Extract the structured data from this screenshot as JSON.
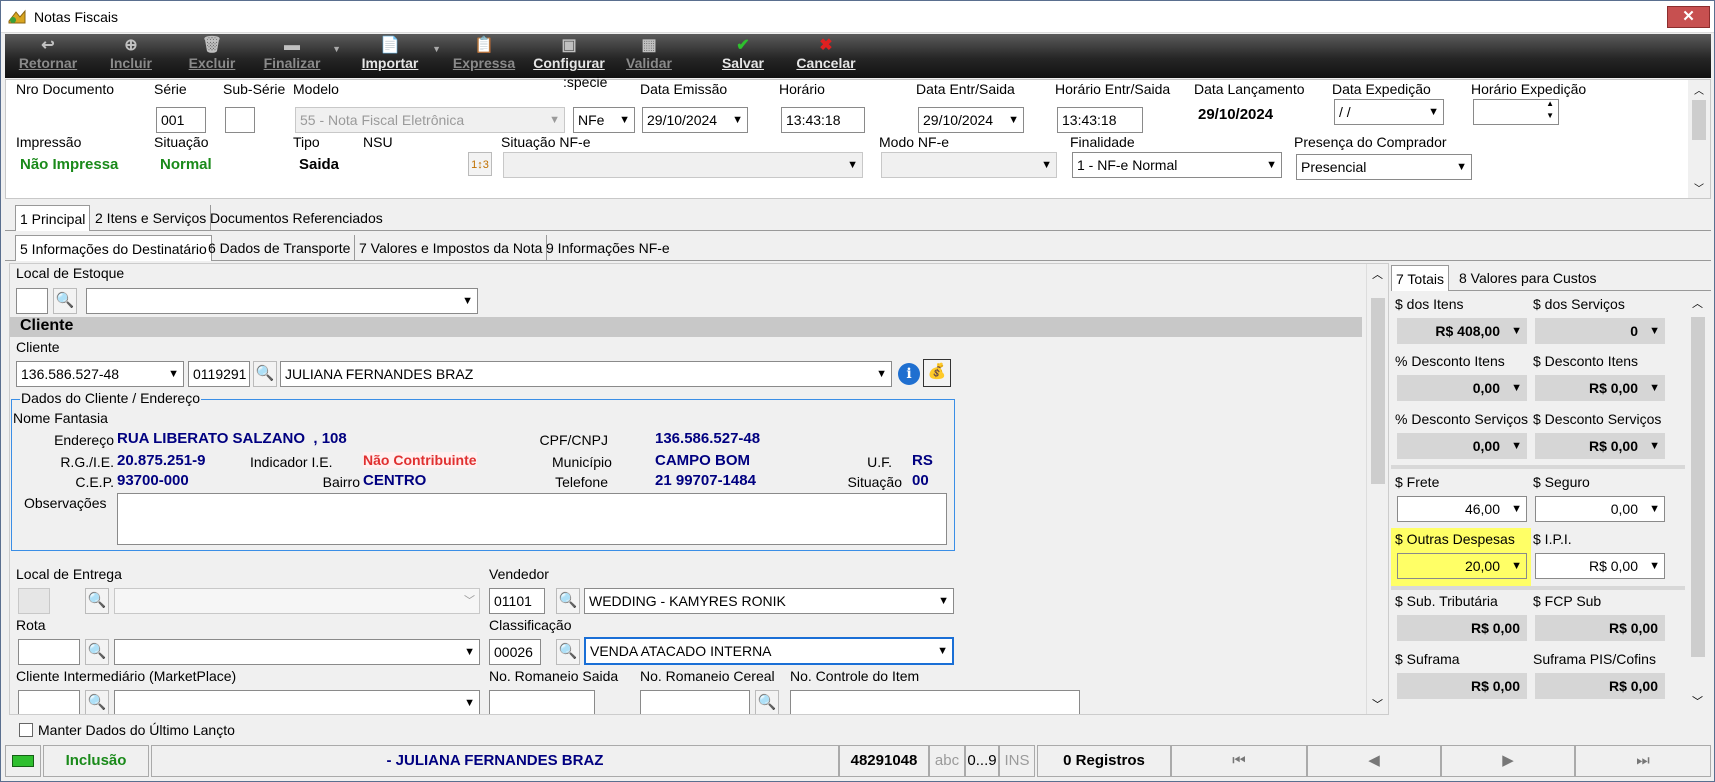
{
  "window": {
    "title": "Notas Fiscais",
    "close": "✕"
  },
  "toolbar": [
    {
      "label": "Retornar",
      "icon": "back-icon",
      "glyph": "↩",
      "enabled": false
    },
    {
      "label": "Incluir",
      "icon": "add-icon",
      "glyph": "⊕",
      "enabled": false
    },
    {
      "label": "Excluir",
      "icon": "trash-icon",
      "glyph": "🗑",
      "enabled": false
    },
    {
      "label": "Finalizar",
      "icon": "finish-icon",
      "glyph": "▬",
      "enabled": false
    },
    {
      "label": "Importar",
      "icon": "import-icon",
      "glyph": "📄",
      "enabled": true
    },
    {
      "label": "Expressa",
      "icon": "express-icon",
      "glyph": "📋",
      "enabled": false
    },
    {
      "label": "Configurar",
      "icon": "config-icon",
      "glyph": "▣",
      "enabled": true
    },
    {
      "label": "Validar",
      "icon": "validate-icon",
      "glyph": "▦",
      "enabled": false
    },
    {
      "label": "Salvar",
      "icon": "check-icon",
      "glyph": "✔",
      "enabled": true
    },
    {
      "label": "Cancelar",
      "icon": "cancel-icon",
      "glyph": "✖",
      "enabled": true
    }
  ],
  "header": {
    "nro_documento": {
      "label": "Nro Documento"
    },
    "serie": {
      "label": "Série",
      "value": "001"
    },
    "sub_serie": {
      "label": "Sub-Série",
      "value": ""
    },
    "modelo": {
      "label": "Modelo",
      "value": "55 - Nota Fiscal Eletrônica"
    },
    "especie": {
      "label": ":specie",
      "value": "NFe"
    },
    "data_emissao": {
      "label": "Data Emissão",
      "value": "29/10/2024"
    },
    "horario": {
      "label": "Horário",
      "value": "13:43:18"
    },
    "data_entr_saida": {
      "label": "Data Entr/Saida",
      "value": "29/10/2024"
    },
    "horario_entr_saida": {
      "label": "Horário Entr/Saida",
      "value": "13:43:18"
    },
    "data_lancamento": {
      "label": "Data Lançamento",
      "value": "29/10/2024"
    },
    "data_expedicao": {
      "label": "Data Expedição",
      "value": " / /"
    },
    "horario_expedicao": {
      "label": "Horário Expedição",
      "value": ""
    },
    "impressao": {
      "label": "Impressão",
      "value": "Não Impressa"
    },
    "situacao": {
      "label": "Situação",
      "value": "Normal"
    },
    "tipo": {
      "label": "Tipo",
      "value": "Saida"
    },
    "nsu": {
      "label": "NSU"
    },
    "situacao_nfe": {
      "label": "Situação NF-e",
      "value": ""
    },
    "modo_nfe": {
      "label": "Modo NF-e",
      "value": ""
    },
    "finalidade": {
      "label": "Finalidade",
      "value": "1 - NF-e Normal"
    },
    "presenca": {
      "label": "Presença do Comprador",
      "value": "Presencial"
    }
  },
  "main_tabs": [
    "1 Principal",
    "2 Itens e Serviços",
    "Documentos Referenciados"
  ],
  "sub_tabs": [
    "5 Informações do Destinatário",
    "6 Dados de Transporte",
    "7 Valores e Impostos da Nota",
    "9 Informações NF-e"
  ],
  "local_estoque": {
    "label": "Local de Estoque",
    "code": "",
    "value": ""
  },
  "cliente_section": {
    "title": "Cliente"
  },
  "cliente": {
    "label": "Cliente",
    "cpf": "136.586.527-48",
    "code": "0119291",
    "name": "JULIANA FERNANDES BRAZ"
  },
  "dados_cliente": {
    "group_title": "Dados do Cliente / Endereço",
    "nome_fantasia_label": "Nome Fantasia",
    "endereco_label": "Endereço",
    "endereco": "RUA LIBERATO SALZANO  , 108",
    "cpf_cnpj_label": "CPF/CNPJ",
    "cpf_cnpj": "136.586.527-48",
    "rg_label": "R.G./I.E.",
    "rg": "20.875.251-9",
    "indicador_label": "Indicador I.E.",
    "indicador": "Não Contribuinte",
    "municipio_label": "Município",
    "municipio": "CAMPO BOM",
    "uf_label": "U.F.",
    "uf": "RS",
    "cep_label": "C.E.P.",
    "cep": "93700-000",
    "bairro_label": "Bairro",
    "bairro": "CENTRO",
    "telefone_label": "Telefone",
    "telefone": "21 99707-1484",
    "situacao_label": "Situação",
    "situacao": "00",
    "observacoes_label": "Observações",
    "observacoes": ""
  },
  "local_entrega": {
    "label": "Local de Entrega",
    "code": "",
    "value": ""
  },
  "vendedor": {
    "label": "Vendedor",
    "code": "01101",
    "value": "WEDDING - KAMYRES RONIK"
  },
  "rota": {
    "label": "Rota",
    "code": "",
    "value": ""
  },
  "classificacao": {
    "label": "Classificação",
    "code": "00026",
    "value": "VENDA ATACADO INTERNA"
  },
  "cliente_intermediario": {
    "label": "Cliente Intermediário (MarketPlace)",
    "code": "",
    "value": ""
  },
  "romaneio_saida": {
    "label": "No. Romaneio Saida",
    "value": ""
  },
  "romaneio_cereal": {
    "label": "No. Romaneio Cereal",
    "value": ""
  },
  "controle_item": {
    "label": "No. Controle do Item",
    "value": ""
  },
  "totais_tabs": [
    "7 Totais",
    "8 Valores para Custos"
  ],
  "totais": {
    "itens": {
      "label": "$ dos Itens",
      "value": "R$ 408,00"
    },
    "servicos": {
      "label": "$ dos Serviços",
      "value": "0"
    },
    "pct_desc_itens": {
      "label": "% Desconto Itens",
      "value": "0,00"
    },
    "desc_itens": {
      "label": "$ Desconto Itens",
      "value": "R$ 0,00"
    },
    "pct_desc_servicos": {
      "label": "% Desconto Serviços",
      "value": "0,00"
    },
    "desc_servicos": {
      "label": "$ Desconto Serviços",
      "value": "R$ 0,00"
    },
    "frete": {
      "label": "$ Frete",
      "value": "46,00"
    },
    "seguro": {
      "label": "$ Seguro",
      "value": "0,00"
    },
    "outras": {
      "label": "$ Outras Despesas",
      "value": "20,00"
    },
    "ipi": {
      "label": "$ I.P.I.",
      "value": "R$ 0,00"
    },
    "sub_trib": {
      "label": "$ Sub. Tributária",
      "value": "R$ 0,00"
    },
    "fcp_sub": {
      "label": "$ FCP Sub",
      "value": "R$ 0,00"
    },
    "suframa": {
      "label": "$ Suframa",
      "value": "R$ 0,00"
    },
    "suframa_pis": {
      "label": "Suframa PIS/Cofins",
      "value": "R$ 0,00"
    }
  },
  "manter_dados": {
    "label": "Manter Dados do Último Lançto",
    "checked": false
  },
  "status": {
    "mode": "Inclusão",
    "client": "- JULIANA FERNANDES BRAZ",
    "number": "48291048",
    "abc": "abc",
    "num": "0...9",
    "ins": "INS",
    "registros": "0 Registros"
  },
  "colors": {
    "accent_green": "#1a8a1a",
    "dark_blue": "#000080",
    "highlight": "#ffff66",
    "red_text": "#e03030"
  }
}
